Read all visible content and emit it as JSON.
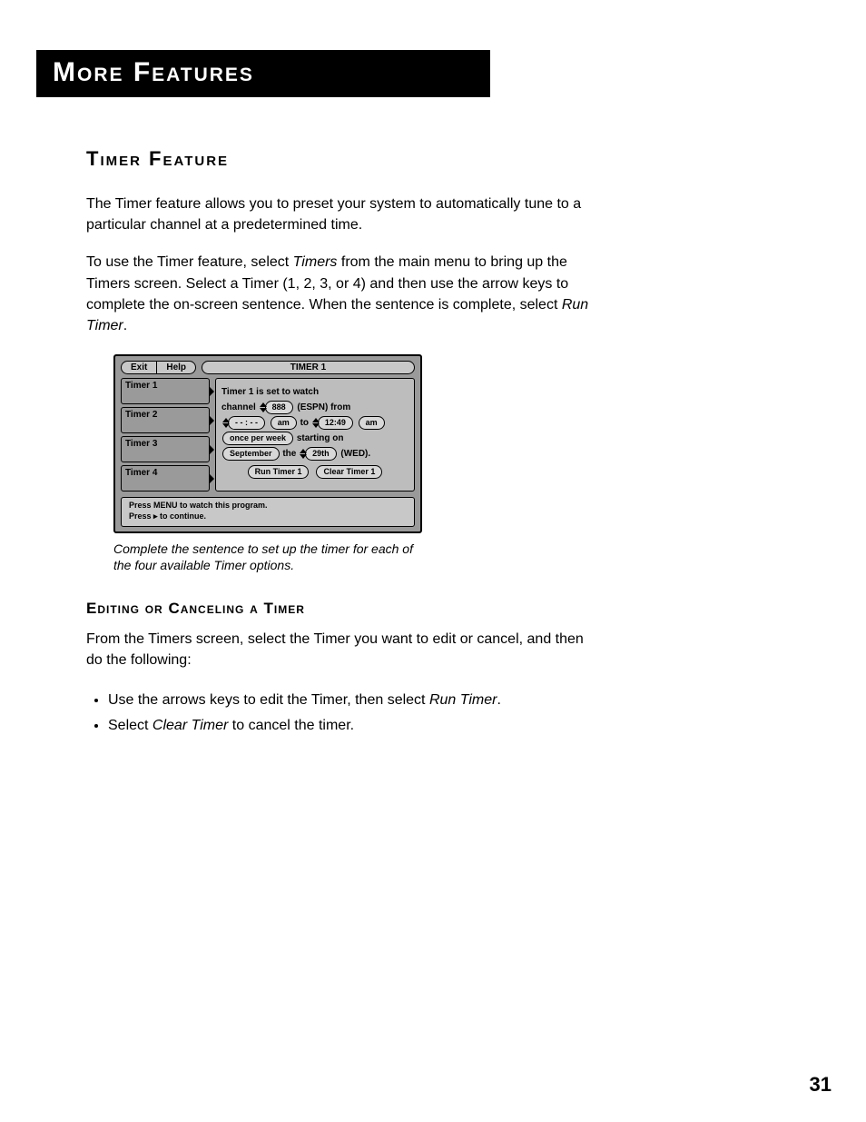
{
  "header": {
    "title": "More Features"
  },
  "section": {
    "title": "Timer Feature",
    "intro": "The Timer feature allows you to preset your system to automatically tune to a particular channel at a predetermined time.",
    "instructions_pre": "To use the Timer feature, select ",
    "instructions_em1": "Timers",
    "instructions_mid": " from the main menu to bring up the Timers screen.  Select a Timer (1, 2, 3, or 4) and then use the arrow keys to complete the on-screen sentence. When the sentence is complete, select ",
    "instructions_em2": "Run Timer",
    "instructions_post": "."
  },
  "screenshot": {
    "buttons": {
      "exit": "Exit",
      "help": "Help"
    },
    "panel_title": "TIMER 1",
    "timers": [
      "Timer 1",
      "Timer 2",
      "Timer 3",
      "Timer 4"
    ],
    "sentence": {
      "lead": "Timer 1 is set to watch",
      "channel_word": "channel",
      "channel_value": "888",
      "channel_name": "(ESPN)",
      "from": "from",
      "time_from_value": "- - : - -",
      "time_from_ampm": "am",
      "to": "to",
      "time_to_value": "12:49",
      "time_to_ampm": "am",
      "frequency": "once per week",
      "starting_on": "starting on",
      "month": "September",
      "the": "the",
      "day": "29th",
      "weekday": "(WED)."
    },
    "actions": {
      "run": "Run Timer 1",
      "clear": "Clear Timer 1"
    },
    "footer_line1": "Press MENU to watch this program.",
    "footer_line2": "Press ▸ to continue."
  },
  "caption": "Complete the sentence to set up the timer for each of the four available Timer options.",
  "subsection": {
    "title": "Editing or Canceling a Timer",
    "intro": "From the Timers screen, select the Timer you want to edit or cancel, and then do the following:",
    "bullets": [
      {
        "pre": "Use the arrows keys to edit the Timer, then select ",
        "em": "Run Timer",
        "post": "."
      },
      {
        "pre": "Select ",
        "em": "Clear Timer",
        "post": " to cancel the timer."
      }
    ]
  },
  "page_number": "31"
}
